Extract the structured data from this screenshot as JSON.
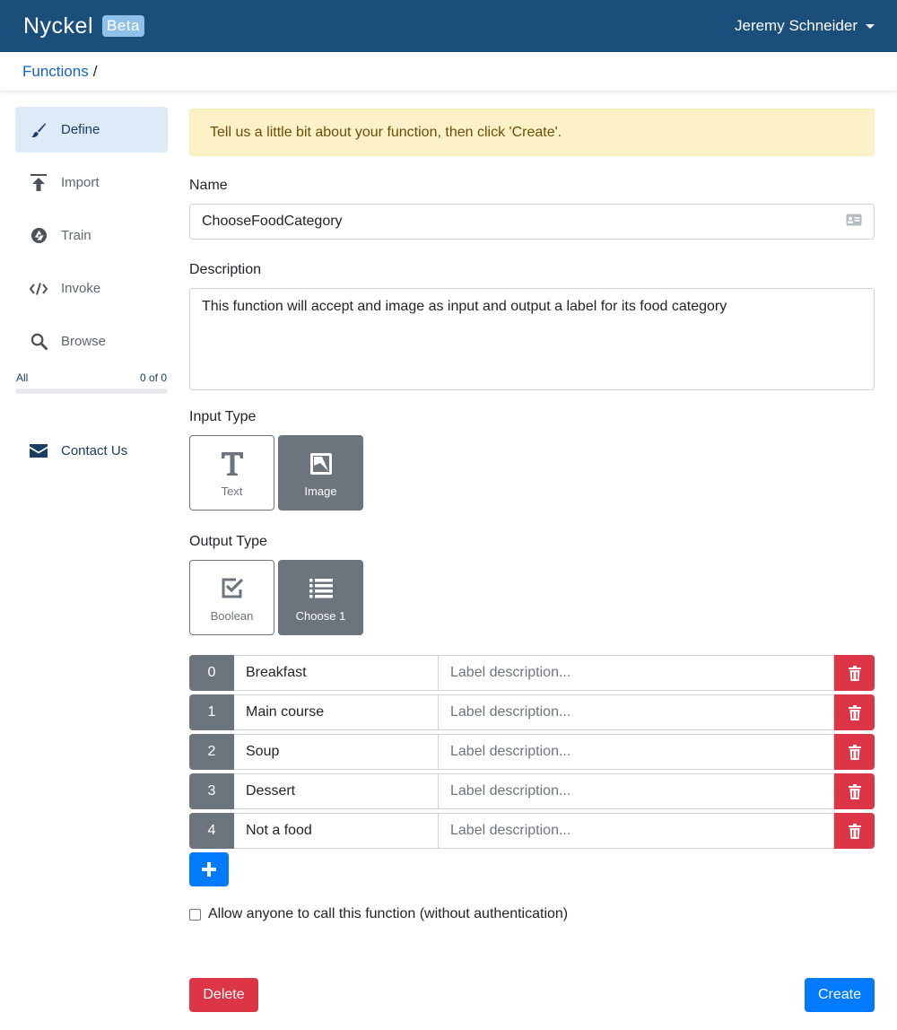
{
  "header": {
    "brand": "Nyckel",
    "badge": "Beta",
    "user": "Jeremy Schneider"
  },
  "breadcrumb": {
    "link": "Functions",
    "separator": "/"
  },
  "sidebar": {
    "items": [
      {
        "label": "Define",
        "icon": "brush-icon",
        "active": true
      },
      {
        "label": "Import",
        "icon": "upload-icon"
      },
      {
        "label": "Train",
        "icon": "aperture-icon"
      },
      {
        "label": "Invoke",
        "icon": "code-icon"
      },
      {
        "label": "Browse",
        "icon": "search-icon"
      }
    ],
    "progress": {
      "label": "All",
      "count": "0 of 0",
      "fraction": 0
    },
    "contact": {
      "label": "Contact Us",
      "icon": "envelope-icon"
    }
  },
  "main": {
    "alert": "Tell us a little bit about your function, then click 'Create'.",
    "name_label": "Name",
    "name_value": "ChooseFoodCategory",
    "description_label": "Description",
    "description_value": "This function will accept and image as input and output a label for its food category",
    "input_type_label": "Input Type",
    "input_types": [
      {
        "label": "Text",
        "icon": "text-icon",
        "selected": false
      },
      {
        "label": "Image",
        "icon": "image-icon",
        "selected": true
      }
    ],
    "output_type_label": "Output Type",
    "output_types": [
      {
        "label": "Boolean",
        "icon": "checkbox-icon",
        "selected": false
      },
      {
        "label": "Choose 1",
        "icon": "list-icon",
        "selected": true
      }
    ],
    "labels": [
      {
        "index": "0",
        "name": "Breakfast",
        "desc_placeholder": "Label description..."
      },
      {
        "index": "1",
        "name": "Main course",
        "desc_placeholder": "Label description..."
      },
      {
        "index": "2",
        "name": "Soup",
        "desc_placeholder": "Label description..."
      },
      {
        "index": "3",
        "name": "Dessert",
        "desc_placeholder": "Label description..."
      },
      {
        "index": "4",
        "name": "Not a food",
        "desc_placeholder": "Label description..."
      }
    ],
    "allow_anon_label": "Allow anyone to call this function (without authentication)",
    "delete_label": "Delete",
    "create_label": "Create"
  },
  "colors": {
    "header_bg": "#1b4f7b",
    "primary": "#007bff",
    "danger": "#dc3545",
    "secondary": "#6c757d",
    "alert_bg": "#fdf1c7"
  }
}
